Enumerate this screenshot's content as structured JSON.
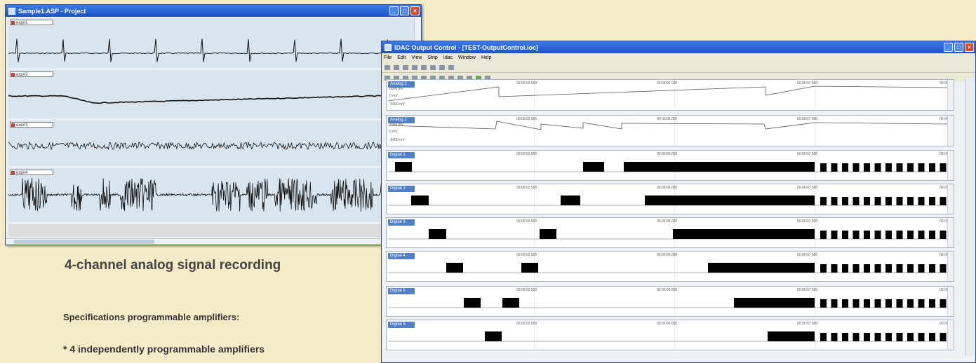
{
  "left_window": {
    "title": "Sample1.ASP - Project",
    "channels": [
      {
        "label": "exp#1"
      },
      {
        "label": "exp#2"
      },
      {
        "label": "exp#3"
      },
      {
        "label": "exp#4"
      }
    ]
  },
  "right_window": {
    "title": "IDAC Output Control - [TEST-OutputControl.ioc]",
    "menu": [
      "File",
      "Edit",
      "View",
      "Strip",
      "Idac",
      "Window",
      "Help"
    ],
    "time_ticks": [
      "00:00:02.500",
      "00:00:05.000",
      "00:00:07.500",
      "00:00"
    ],
    "analog_strips": [
      {
        "label": "Analog 1",
        "units": [
          "5000 mV",
          "0 mV",
          "-5000 mV"
        ]
      },
      {
        "label": "Analog 2",
        "units": [
          "5000 mV",
          "0 mV",
          "-5000 mV"
        ]
      }
    ],
    "digital_strips": [
      {
        "label": "Digital 1"
      },
      {
        "label": "Digital 2"
      },
      {
        "label": "Digital 3"
      },
      {
        "label": "Digital 4"
      },
      {
        "label": "Digital 5"
      },
      {
        "label": "Digital 6"
      }
    ]
  },
  "caption": "4-channel analog signal recording",
  "specs": {
    "heading": "Specifications programmable amplifiers:",
    "items": [
      "* 4 independently programmable amplifiers"
    ]
  },
  "colors": {
    "background": "#f6ebc8",
    "titlebar": "#1d53c4",
    "strip_bg": "#d8e4ee",
    "label_bg": "#4f7fc6"
  }
}
